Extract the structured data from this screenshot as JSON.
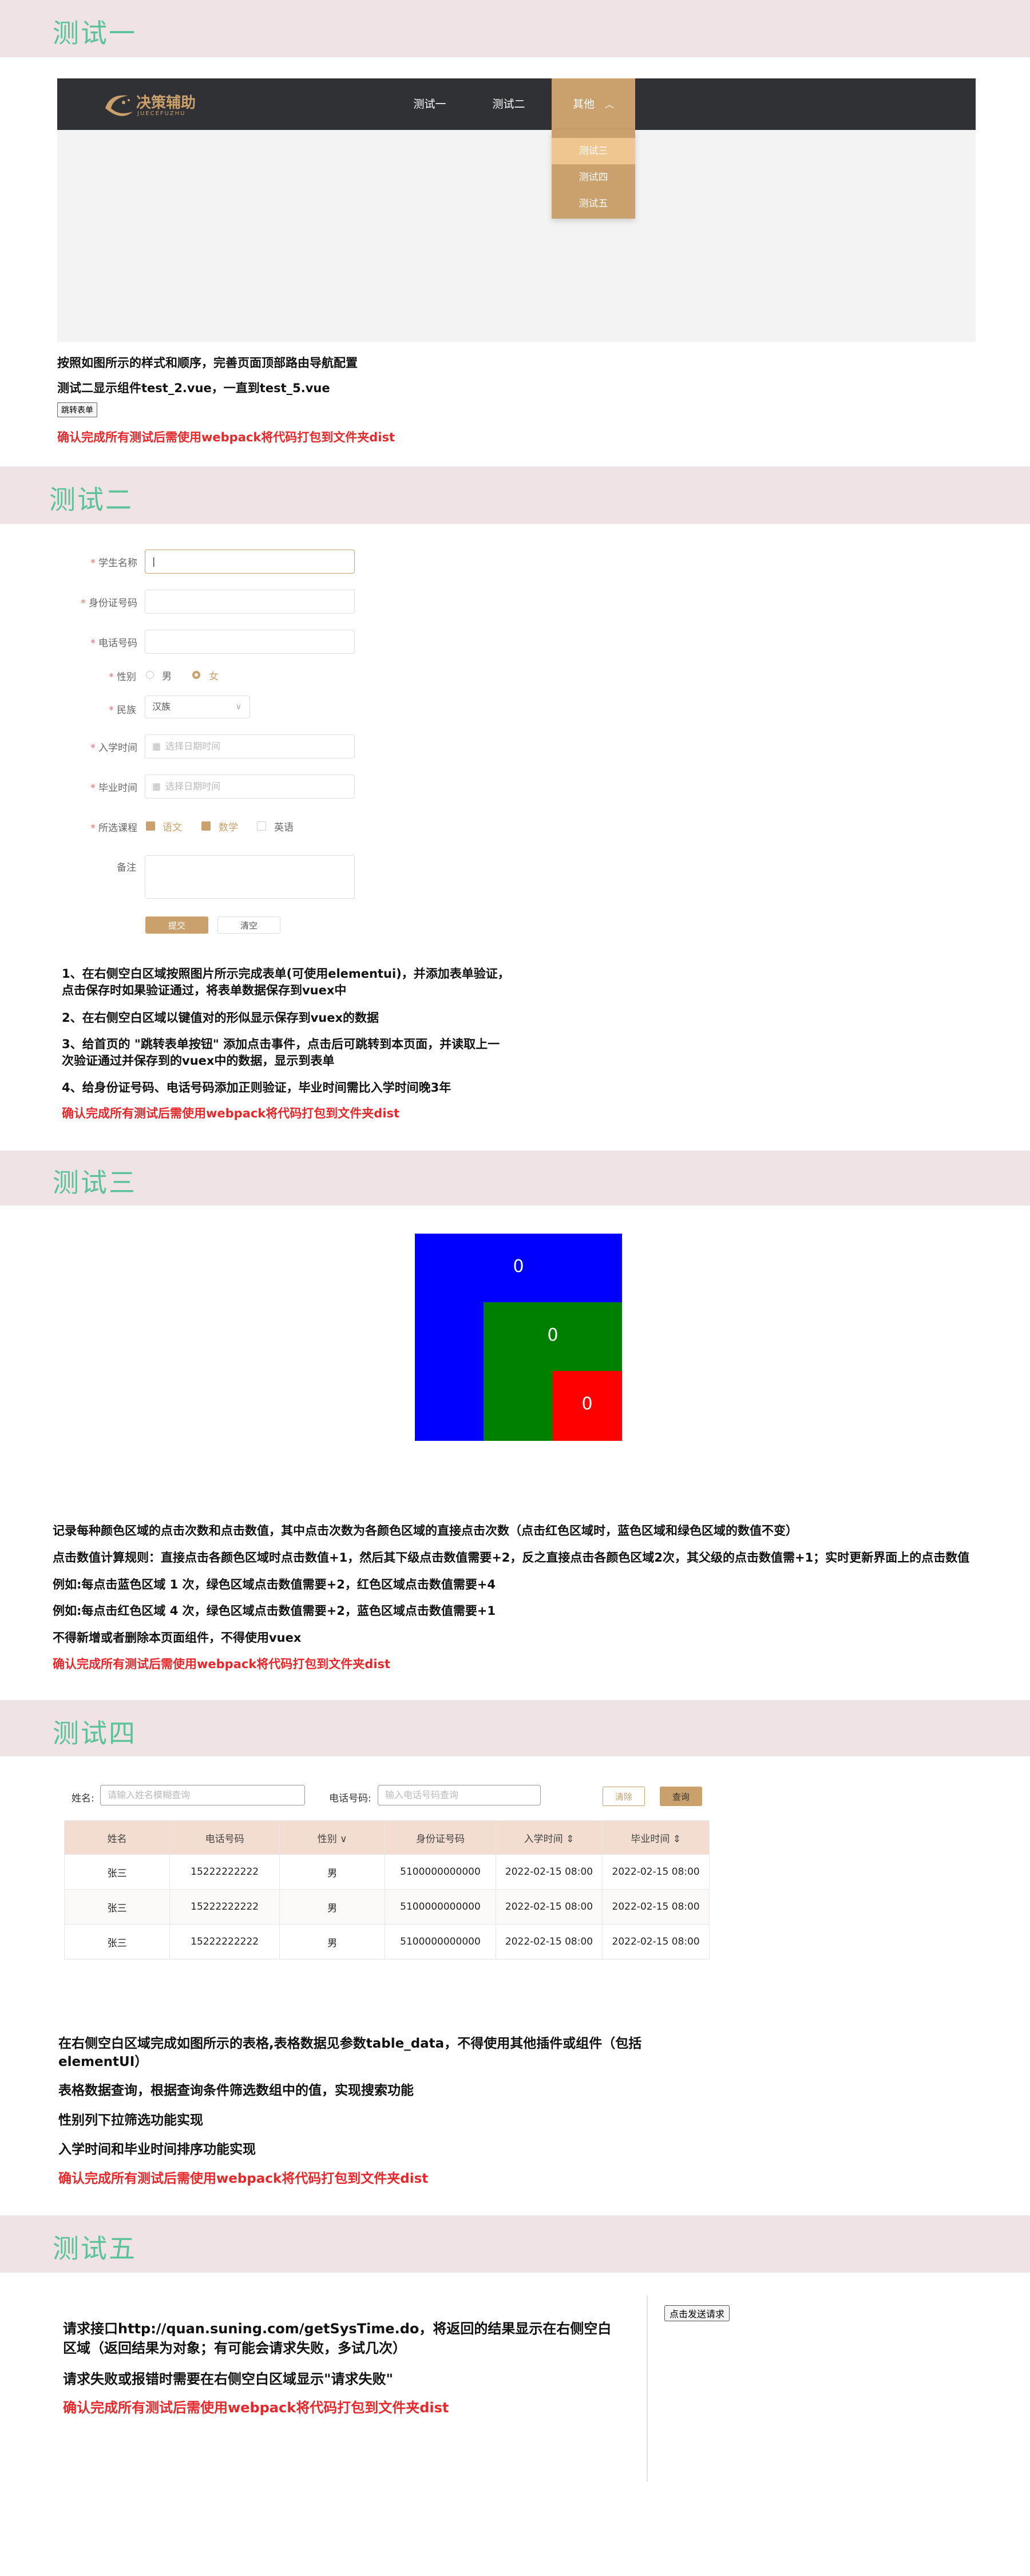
{
  "test1": {
    "title": "测试一",
    "logo_text": "决策辅助",
    "logo_sub": "JUECEFUZHU",
    "nav": [
      "测试一",
      "测试二",
      "其他"
    ],
    "dropdown": [
      "测试三",
      "测试四",
      "测试五"
    ],
    "desc1": "按照如图所示的样式和顺序，完善页面顶部路由导航配置",
    "desc2": "测试二显示组件test_2.vue，一直到test_5.vue",
    "jump_button": "跳转表单",
    "note": "确认完成所有测试后需使用webpack将代码打包到文件夹dist"
  },
  "test2": {
    "title": "测试二",
    "labels": {
      "name": "学生名称",
      "id": "身份证号码",
      "phone": "电话号码",
      "gender": "性别",
      "nation": "民族",
      "enroll": "入学时间",
      "graduate": "毕业时间",
      "courses": "所选课程",
      "remark": "备注"
    },
    "gender_options": [
      "男",
      "女"
    ],
    "gender_selected": "女",
    "nation_value": "汉族",
    "date_placeholder": "选择日期时间",
    "courses": [
      {
        "label": "语文",
        "checked": true
      },
      {
        "label": "数学",
        "checked": true
      },
      {
        "label": "英语",
        "checked": false
      }
    ],
    "submit": "提交",
    "clear": "清空",
    "steps": [
      "1、在右侧空白区域按照图片所示完成表单(可使用elementui)，并添加表单验证，",
      "点击保存时如果验证通过，将表单数据保存到vuex中",
      "2、在右侧空白区域以键值对的形似显示保存到vuex的数据",
      "3、给首页的 \"跳转表单按钮\" 添加点击事件，点击后可跳转到本页面，并读取上一",
      "次验证通过并保存到的vuex中的数据，显示到表单",
      "4、给身份证号码、电话号码添加正则验证，毕业时间需比入学时间晚3年"
    ],
    "note": "确认完成所有测试后需使用webpack将代码打包到文件夹dist"
  },
  "test3": {
    "title": "测试三",
    "blue_count": "0",
    "green_count": "0",
    "red_count": "0",
    "colors": {
      "blue": "#0000ff",
      "green": "#008000",
      "red": "#ff0000"
    },
    "desc": [
      "记录每种颜色区域的点击次数和点击数值，其中点击次数为各颜色区域的直接点击次数（点击红色区域时，蓝色区域和绿色区域的数值不变）",
      "点击数值计算规则：直接点击各颜色区域时点击数值+1，然后其下级点击数值需要+2，反之直接点击各颜色区域2次，其父级的点击数值需+1；实时更新界面上的点击数值",
      "例如:每点击蓝色区域 1 次，绿色区域点击数值需要+2，红色区域点击数值需要+4",
      "例如:每点击红色区域 4 次，绿色区域点击数值需要+2，蓝色区域点击数值需要+1",
      "不得新增或者删除本页面组件，不得使用vuex"
    ],
    "note": "确认完成所有测试后需使用webpack将代码打包到文件夹dist"
  },
  "test4": {
    "title": "测试四",
    "name_label": "姓名:",
    "name_placeholder": "请输入姓名模糊查询",
    "phone_label": "电话号码:",
    "phone_placeholder": "输入电话号码查询",
    "clear": "清除",
    "query": "查询",
    "columns": [
      "姓名",
      "电话号码",
      "性别 ∨",
      "身份证号码",
      "入学时间 ⇕",
      "毕业时间 ⇕"
    ],
    "rows": [
      [
        "张三",
        "15222222222",
        "男",
        "5100000000000",
        "2022-02-15 08:00",
        "2022-02-15 08:00"
      ],
      [
        "张三",
        "15222222222",
        "男",
        "5100000000000",
        "2022-02-15 08:00",
        "2022-02-15 08:00"
      ],
      [
        "张三",
        "15222222222",
        "男",
        "5100000000000",
        "2022-02-15 08:00",
        "2022-02-15 08:00"
      ]
    ],
    "desc": [
      "在右侧空白区域完成如图所示的表格,表格数据见参数table_data，不得使用其他插件或组件（包括",
      "elementUI）",
      "表格数据查询，根据查询条件筛选数组中的值，实现搜索功能",
      "性别列下拉筛选功能实现",
      "入学时间和毕业时间排序功能实现"
    ],
    "note": "确认完成所有测试后需使用webpack将代码打包到文件夹dist"
  },
  "test5": {
    "title": "测试五",
    "desc": [
      "请求接口http://quan.suning.com/getSysTime.do，将返回的结果显示在右侧空白",
      "区域（返回结果为对象；有可能会请求失败，多试几次）",
      "请求失败或报错时需要在右侧空白区域显示\"请求失败\""
    ],
    "note": "确认完成所有测试后需使用webpack将代码打包到文件夹dist",
    "send_button": "点击发送请求"
  }
}
